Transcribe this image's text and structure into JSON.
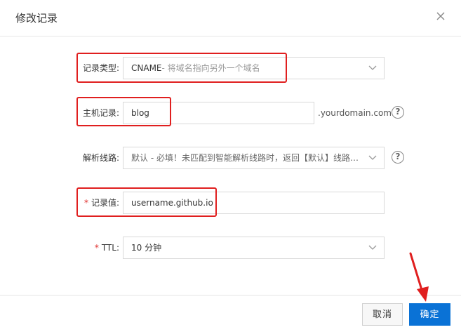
{
  "dialog": {
    "title": "修改记录",
    "close_icon": "close-icon"
  },
  "form": {
    "record_type": {
      "label": "记录类型:",
      "value": "CNAME",
      "hint": "- 将域名指向另外一个域名"
    },
    "host_record": {
      "label": "主机记录:",
      "value": "blog",
      "suffix": ".yourdomain.com"
    },
    "resolution_line": {
      "label": "解析线路:",
      "value": "默认 - 必填！未匹配到智能解析线路时，返回【默认】线路设..."
    },
    "record_value": {
      "required_mark": "*",
      "label": "记录值:",
      "value": "username.github.io"
    },
    "ttl": {
      "required_mark": "*",
      "label": "TTL:",
      "value": "10 分钟"
    }
  },
  "buttons": {
    "cancel_label": "取消",
    "ok_label": "确定"
  },
  "colors": {
    "accent": "#0a72d6",
    "highlight": "#e01f1f",
    "required": "#e0302e"
  }
}
